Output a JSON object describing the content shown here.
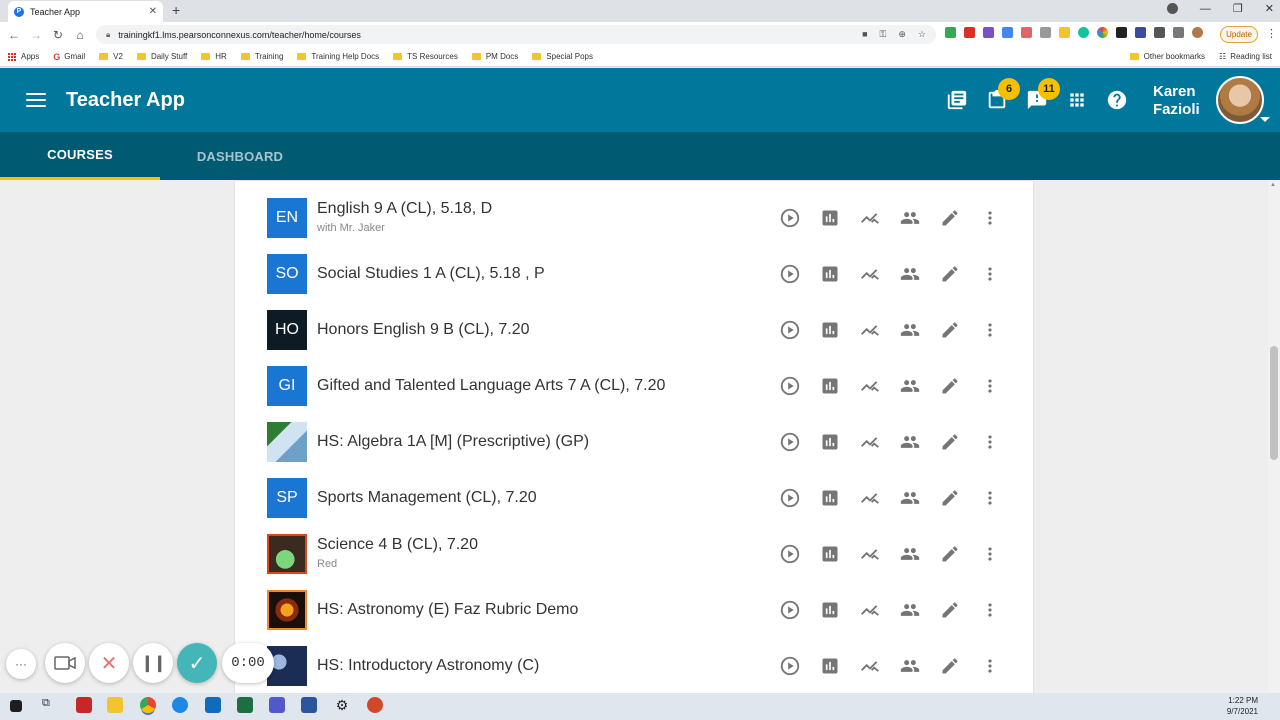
{
  "browser": {
    "tab_title": "Teacher App",
    "url": "trainingkf1.lms.pearsonconnexus.com/teacher/home/courses",
    "update_label": "Update",
    "bookmarks": [
      "Apps",
      "Gmail",
      "V2",
      "Daily Stuff",
      "HR",
      "Training",
      "Training Help Docs",
      "TS Resources",
      "PM Docs",
      "Special Pops"
    ],
    "other_bookmarks": "Other bookmarks",
    "reading_list": "Reading list"
  },
  "header": {
    "title": "Teacher App",
    "assignments_badge": "6",
    "alerts_badge": "11",
    "user_first": "Karen",
    "user_last": "Fazioli"
  },
  "tabs": [
    {
      "label": "COURSES",
      "active": true
    },
    {
      "label": "DASHBOARD",
      "active": false
    }
  ],
  "courses": [
    {
      "abbr": "EN",
      "title": "English 9 A (CL), 5.18, D",
      "subtitle": "with Mr. Jaker",
      "color": "#1976d2"
    },
    {
      "abbr": "SO",
      "title": "Social Studies 1 A (CL), 5.18 , P",
      "subtitle": "",
      "color": "#1976d2"
    },
    {
      "abbr": "HO",
      "title": "Honors English 9 B (CL), 7.20",
      "subtitle": "",
      "color": "#0d1b24"
    },
    {
      "abbr": "GI",
      "title": "Gifted and Talented Language Arts 7 A (CL), 7.20",
      "subtitle": "",
      "color": "#1976d2"
    },
    {
      "abbr": "",
      "title": "HS: Algebra 1A [M] (Prescriptive) (GP)",
      "subtitle": "",
      "image": "algebra-thumbnail"
    },
    {
      "abbr": "SP",
      "title": "Sports Management (CL), 7.20",
      "subtitle": "",
      "color": "#1976d2"
    },
    {
      "abbr": "",
      "title": "Science 4 B (CL), 7.20",
      "subtitle": "Red",
      "image": "science-flask-thumbnail"
    },
    {
      "abbr": "",
      "title": "HS: Astronomy (E) Faz Rubric Demo",
      "subtitle": "",
      "image": "astronomy-sun-thumbnail"
    },
    {
      "abbr": "",
      "title": "HS: Introductory Astronomy (C)",
      "subtitle": "",
      "image": "intro-astronomy-thumbnail"
    }
  ],
  "recorder": {
    "time": "0:00"
  },
  "taskbar": {
    "time": "1:22 PM",
    "date": "9/7/2021"
  },
  "colors": {
    "header": "#00779b",
    "tabbar": "#005a72",
    "accent": "#f6c000",
    "icon_gray": "#757575"
  }
}
